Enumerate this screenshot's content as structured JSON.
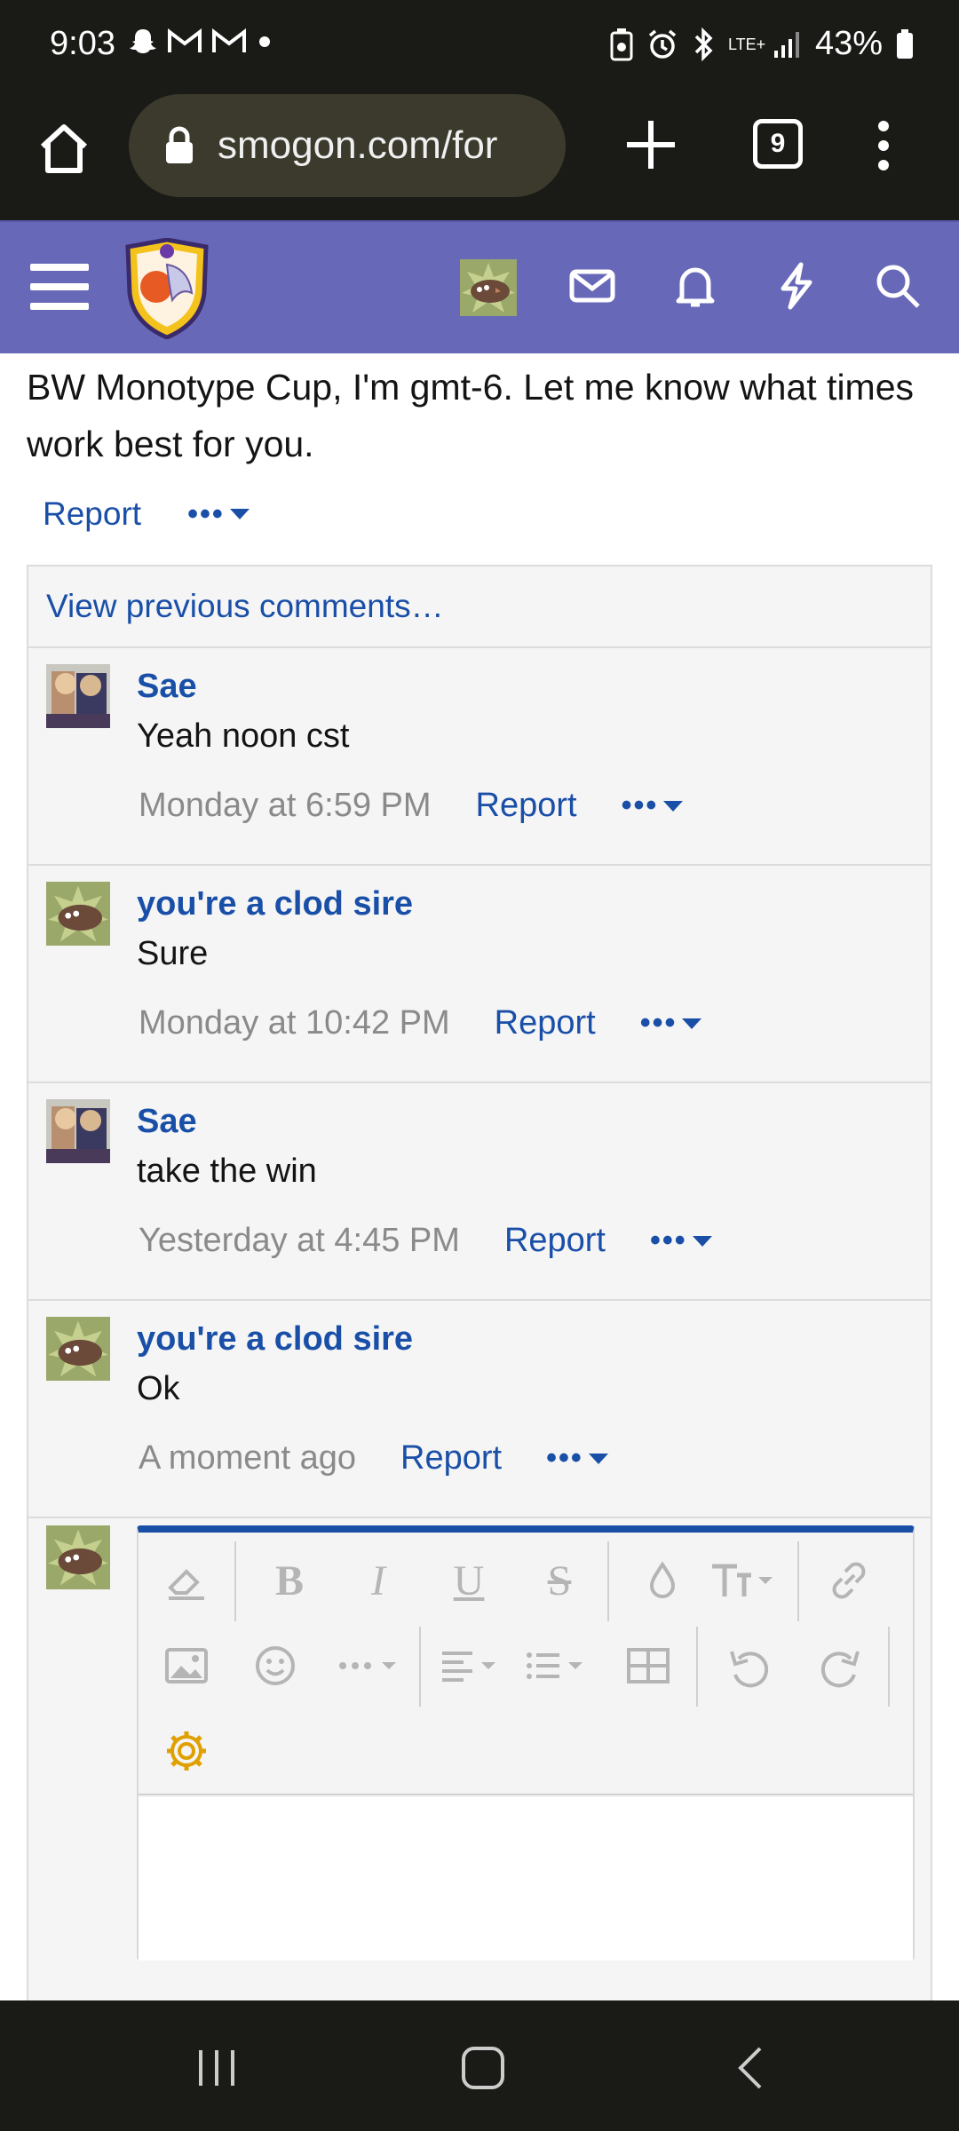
{
  "status_bar": {
    "time": "9:03",
    "battery": "43%",
    "network": "LTE+"
  },
  "browser": {
    "url": "smogon.com/for",
    "tab_count": "9"
  },
  "post": {
    "text": "BW Monotype Cup, I'm gmt-6. Let me know what times work best for you.",
    "report_label": "Report"
  },
  "comments": {
    "view_previous": "View previous comments…",
    "items": [
      {
        "user": "Sae",
        "message": "Yeah noon cst",
        "time": "Monday at 6:59 PM",
        "report": "Report"
      },
      {
        "user": "you're a clod sire",
        "message": "Sure",
        "time": "Monday at 10:42 PM",
        "report": "Report"
      },
      {
        "user": "Sae",
        "message": "take the win",
        "time": "Yesterday at 4:45 PM",
        "report": "Report"
      },
      {
        "user": "you're a clod sire",
        "message": "Ok",
        "time": "A moment ago",
        "report": "Report"
      }
    ]
  },
  "editor": {
    "toolbar": [
      "eraser-icon",
      "bold-icon",
      "italic-icon",
      "underline-icon",
      "strikethrough-icon",
      "text-color-icon",
      "font-size-icon",
      "link-icon",
      "image-icon",
      "emoji-icon",
      "more-icon",
      "align-icon",
      "list-icon",
      "table-icon",
      "undo-icon",
      "redo-icon",
      "settings-icon"
    ]
  },
  "colors": {
    "header": "#6868b9",
    "link": "#1a4fa8",
    "settings_icon": "#e0a000"
  }
}
